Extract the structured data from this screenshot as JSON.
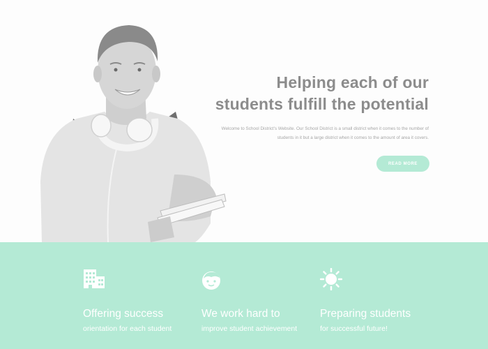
{
  "hero": {
    "title_line1": "Helping each of our",
    "title_line2": "students fulfill the potential",
    "text_line1": "Welcome to School District's Website. Our School District is a small district when it comes to the number of",
    "text_line2": "students in it but a large district when it comes to the amount of area it covers.",
    "button_label": "READ MORE",
    "image": "student-photo"
  },
  "features": [
    {
      "icon": "building-icon",
      "title": "Offering success",
      "subtitle": "orientation for each student"
    },
    {
      "icon": "child-face-icon",
      "title": "We work hard to",
      "subtitle": "improve student achievement"
    },
    {
      "icon": "sun-icon",
      "title": "Preparing students",
      "subtitle": "for successful future!"
    }
  ],
  "colors": {
    "accent": "#b4ead5",
    "title_text": "#8c8c8c",
    "body_text": "#a6a6a6",
    "white": "#ffffff"
  }
}
